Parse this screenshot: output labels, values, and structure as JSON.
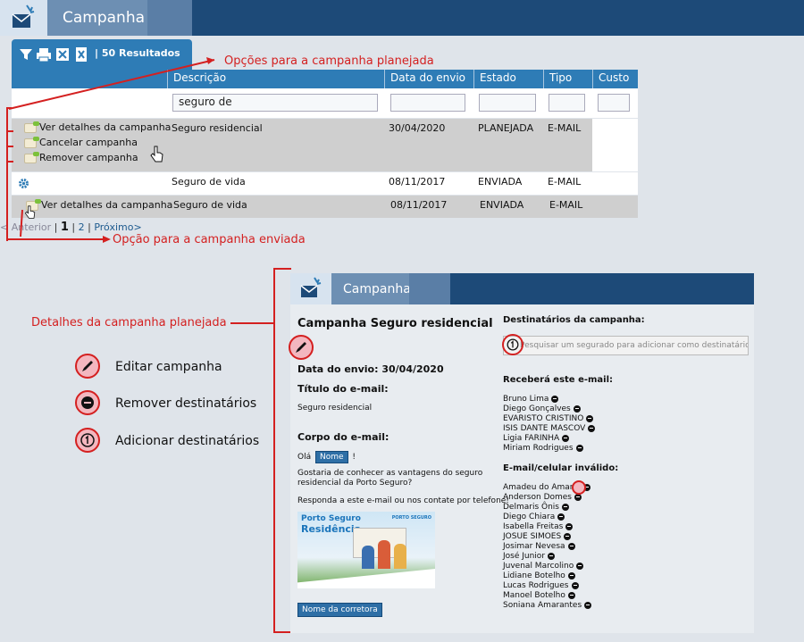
{
  "app": {
    "title": "Campanha"
  },
  "toolbar": {
    "results": "| 50 Resultados",
    "icons": [
      "filter-icon",
      "print-icon",
      "export-icon",
      "excel-icon"
    ]
  },
  "columns": [
    "Descrição",
    "Data do envio",
    "Estado",
    "Tipo",
    "Custo"
  ],
  "filter": {
    "descricao_value": "seguro de"
  },
  "rows": [
    {
      "descricao": "Seguro residencial",
      "data": "30/04/2020",
      "estado": "PLANEJADA",
      "tipo": "E-MAIL"
    },
    {
      "descricao": "Seguro de vida",
      "data": "08/11/2017",
      "estado": "ENVIADA",
      "tipo": "E-MAIL"
    },
    {
      "descricao": "Seguro de vida",
      "data": "08/11/2017",
      "estado": "ENVIADA",
      "tipo": "E-MAIL"
    }
  ],
  "planned_menu": [
    "Ver detalhes da campanha",
    "Cancelar campanha",
    "Remover campanha"
  ],
  "sent_menu": [
    "Ver detalhes da campanha"
  ],
  "pager": {
    "prev": "< Anterior",
    "sep": "|",
    "current": "1",
    "page2": "2",
    "next": "Próximo>"
  },
  "annotations": {
    "planned_options": "Opções para a campanha planejada",
    "sent_option": "Opção para a campanha enviada",
    "details": "Detalhes da campanha planejada"
  },
  "legend": [
    "Editar campanha",
    "Remover destinatários",
    "Adicionar destinatários"
  ],
  "details": {
    "app_title": "Campanha",
    "title": "Campanha Seguro residencial",
    "send_date": "Data do envio: 30/04/2020",
    "email_title_label": "Título do e-mail:",
    "email_title": "Seguro residencial",
    "body_label": "Corpo do e-mail:",
    "greeting_prefix": "Olá",
    "name_tag": "Nome",
    "greeting_suffix": "!",
    "body_line1": "Gostaria de conhecer as vantagens do seguro",
    "body_line2": "residencial da Porto Seguro?",
    "body_line3": "Responda a este e-mail ou nos contate por telefone!",
    "banner_brand": "Porto Seguro",
    "banner_title": "Residência",
    "banner_logo": "PORTO SEGURO",
    "broker_tag": "Nome da corretora",
    "recipients_label": "Destinatários da campanha:",
    "search_placeholder": "Pesquisar um segurado para adicionar como destinatário",
    "will_receive_label": "Receberá este e-mail:",
    "receivers": [
      "Bruno Lima",
      "Diego Gonçalves",
      "EVARISTO CRISTINO",
      "ISIS DANTE MASCOV",
      "Ligia FARINHA",
      "Miriam Rodrigues"
    ],
    "invalid_label": "E-mail/celular inválido:",
    "invalid": [
      "Amadeu do Amaral",
      "Anderson Domes",
      "Delmaris Ônis",
      "Diego Chiara",
      "Isabella Freitas",
      "JOSUE SIMOES",
      "Josimar Nevesa",
      "José Junior",
      "Juvenal Marcolino",
      "Lidiane Botelho",
      "Lucas Rodrigues",
      "Manoel Botelho",
      "Soniana Amarantes"
    ]
  },
  "colors": {
    "header": "#1d4a78",
    "accent": "#2e7cb6",
    "annotation": "#d42020"
  }
}
